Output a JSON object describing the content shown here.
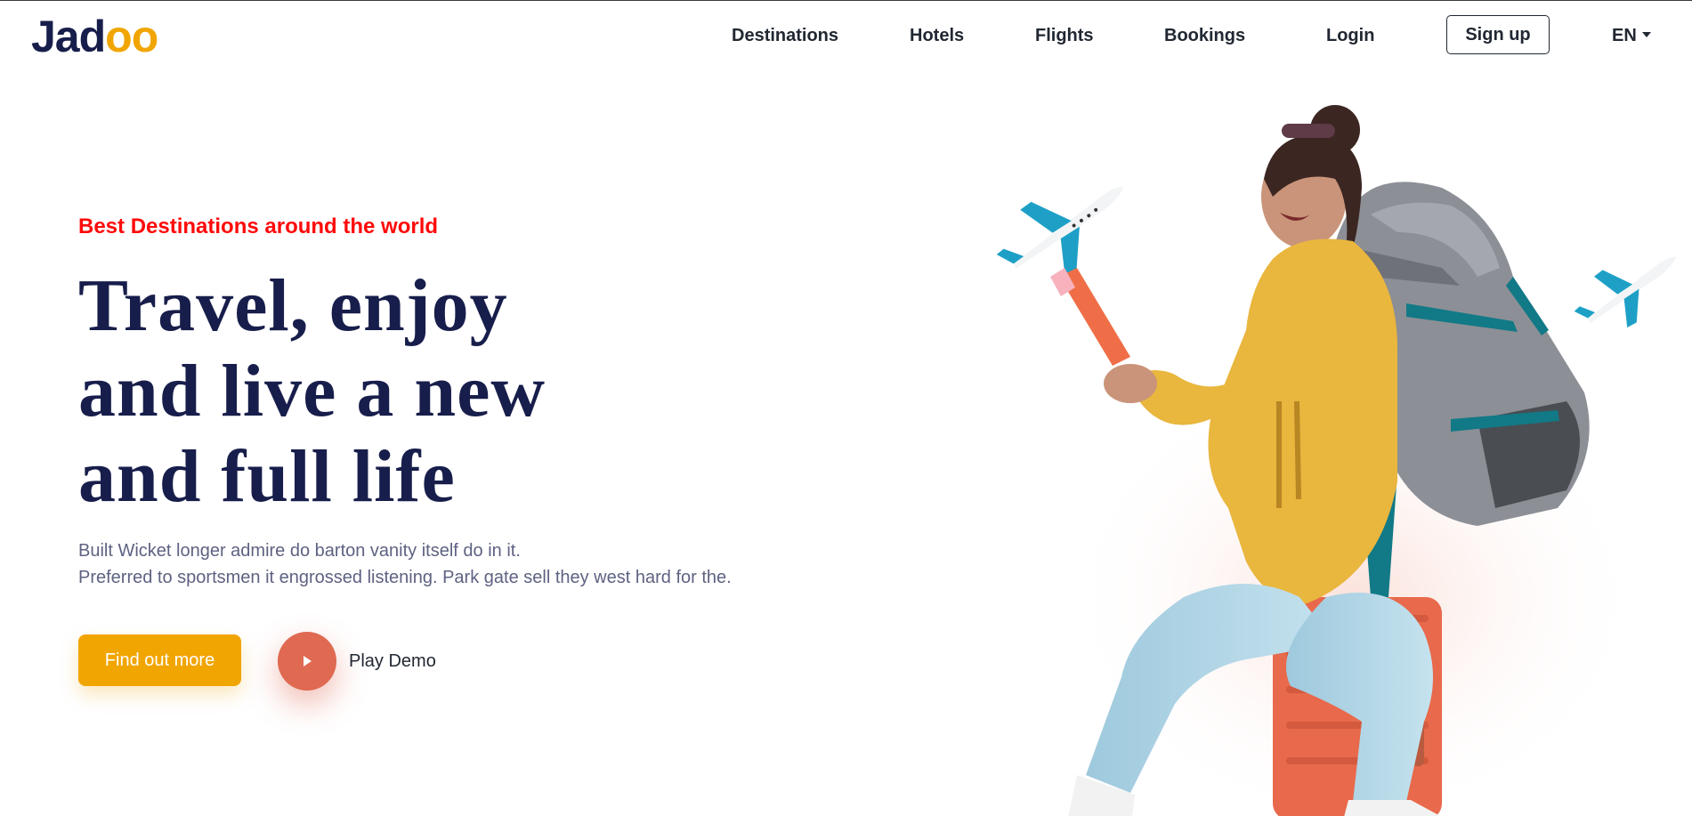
{
  "brand": {
    "logo_base": "Jad",
    "logo_accent": "oo"
  },
  "nav": {
    "items": [
      {
        "label": "Destinations"
      },
      {
        "label": "Hotels"
      },
      {
        "label": "Flights"
      },
      {
        "label": "Bookings"
      },
      {
        "label": "Login"
      }
    ],
    "signup_label": "Sign up",
    "language": "EN"
  },
  "hero": {
    "eyebrow": "Best Destinations around the world",
    "headline": {
      "line1_prefix": "Travel, ",
      "line1_highlight": "enjoy",
      "line2": "and live a new",
      "line3": "and full life"
    },
    "description": {
      "line1": "Built Wicket longer admire do barton vanity itself do in it.",
      "line2": "Preferred to sportsmen it engrossed listening. Park gate sell they west hard for the."
    },
    "cta_label": "Find out more",
    "demo_label": "Play Demo"
  },
  "icons": {
    "play": "play-icon",
    "caret": "chevron-down-icon",
    "plane": "airplane-icon"
  },
  "colors": {
    "navy": "#181e4b",
    "accent_yellow": "#f1a501",
    "accent_coral": "#df6951",
    "eyebrow_red": "#ff0a0a",
    "muted_text": "#5e6282"
  }
}
